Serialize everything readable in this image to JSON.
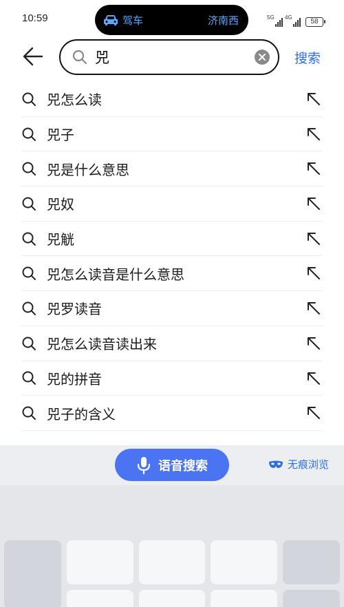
{
  "status": {
    "time": "10:59",
    "island_label": "驾车",
    "island_destination": "济南西",
    "signal1": "5G",
    "signal2": "4G",
    "battery": "58"
  },
  "search": {
    "query": "兕",
    "button_label": "搜索"
  },
  "suggestions": [
    "兕怎么读",
    "兕子",
    "兕是什么意思",
    "兕奴",
    "兕觥",
    "兕怎么读音是什么意思",
    "兕罗读音",
    "兕怎么读音读出来",
    "兕的拼音",
    "兕子的含义"
  ],
  "bottom_bar": {
    "voice_label": "语音搜索",
    "incognito_label": "无痕浏览"
  },
  "colors": {
    "accent": "#2f6fe0",
    "voice_button": "#4a74f2",
    "island_text": "#5aa9ff"
  }
}
